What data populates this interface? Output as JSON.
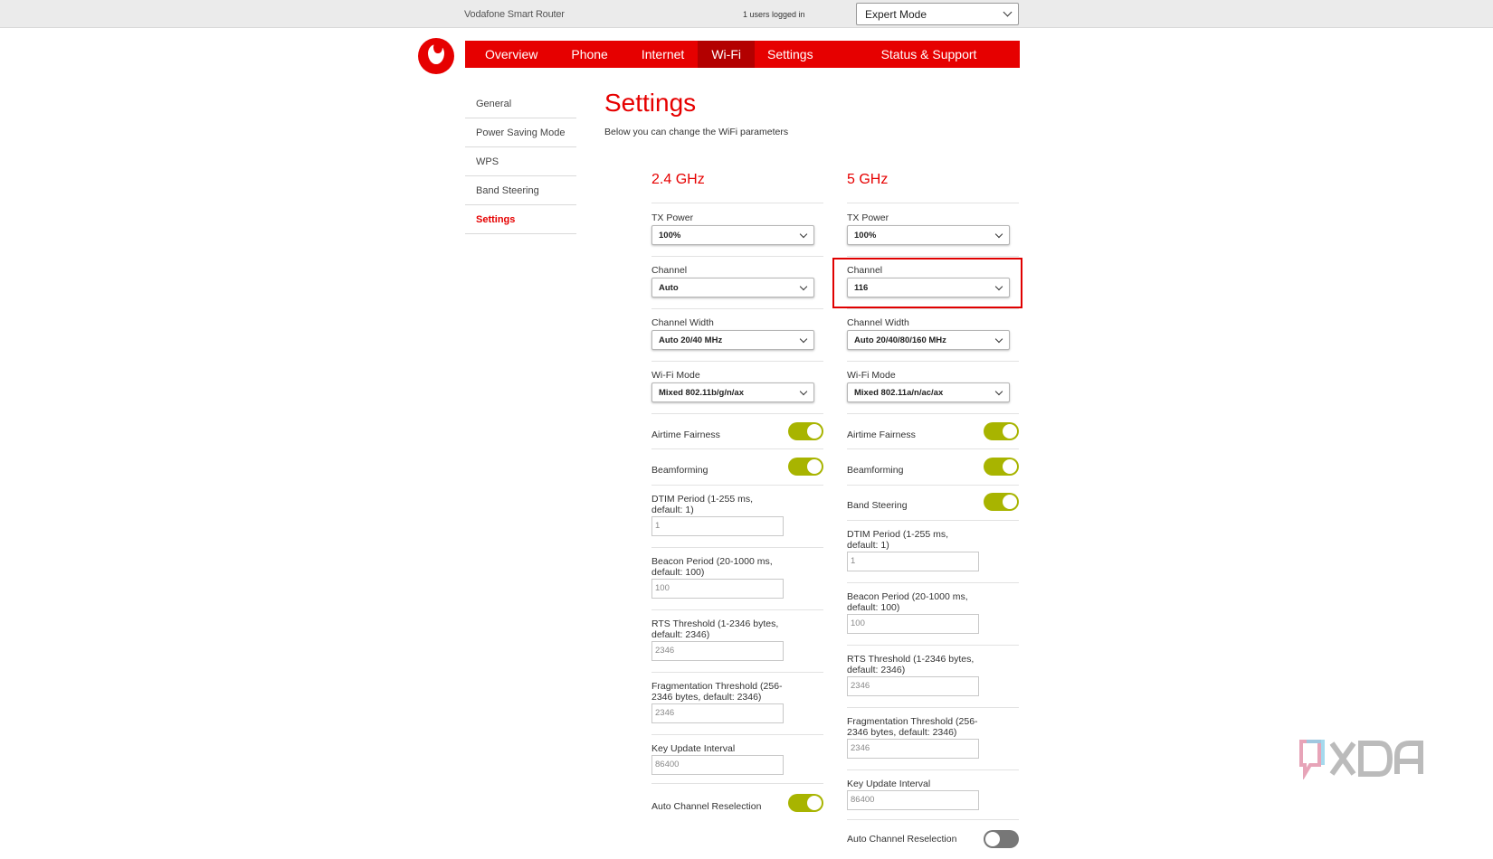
{
  "topbar": {
    "brand": "Vodafone Smart Router",
    "users": "1 users logged in",
    "mode": "Expert Mode"
  },
  "nav": [
    "Overview",
    "Phone",
    "Internet",
    "Wi-Fi",
    "Settings",
    "Status & Support"
  ],
  "sidebar": [
    "General",
    "Power Saving Mode",
    "WPS",
    "Band Steering",
    "Settings"
  ],
  "page": {
    "title": "Settings",
    "subtitle": "Below you can change the WiFi parameters"
  },
  "band24": {
    "title": "2.4 GHz",
    "tx_label": "TX Power",
    "tx_value": "100%",
    "channel_label": "Channel",
    "channel_value": "Auto",
    "width_label": "Channel Width",
    "width_value": "Auto 20/40 MHz",
    "mode_label": "Wi-Fi Mode",
    "mode_value": "Mixed 802.11b/g/n/ax",
    "airtime_label": "Airtime Fairness",
    "beam_label": "Beamforming",
    "dtim_label1": "DTIM Period (1-255 ms,",
    "dtim_label2": "default: 1)",
    "dtim_value": "1",
    "beacon_label1": "Beacon Period (20-1000 ms,",
    "beacon_label2": "default: 100)",
    "beacon_value": "100",
    "rts_label1": "RTS Threshold (1-2346 bytes,",
    "rts_label2": "default: 2346)",
    "rts_value": "2346",
    "frag_label1": "Fragmentation Threshold (256-",
    "frag_label2": "2346 bytes, default: 2346)",
    "frag_value": "2346",
    "key_label": "Key Update Interval",
    "key_value": "86400",
    "acr_label": "Auto Channel Reselection"
  },
  "band5": {
    "title": "5 GHz",
    "tx_label": "TX Power",
    "tx_value": "100%",
    "channel_label": "Channel",
    "channel_value": "116",
    "width_label": "Channel Width",
    "width_value": "Auto 20/40/80/160 MHz",
    "mode_label": "Wi-Fi Mode",
    "mode_value": "Mixed 802.11a/n/ac/ax",
    "airtime_label": "Airtime Fairness",
    "beam_label": "Beamforming",
    "steer_label": "Band Steering",
    "dtim_label1": "DTIM Period (1-255 ms,",
    "dtim_label2": "default: 1)",
    "dtim_value": "1",
    "beacon_label1": "Beacon Period (20-1000 ms,",
    "beacon_label2": "default: 100)",
    "beacon_value": "100",
    "rts_label1": "RTS Threshold (1-2346 bytes,",
    "rts_label2": "default: 2346)",
    "rts_value": "2346",
    "frag_label1": "Fragmentation Threshold (256-",
    "frag_label2": "2346 bytes, default: 2346)",
    "frag_value": "2346",
    "key_label": "Key Update Interval",
    "key_value": "86400",
    "acr_label": "Auto Channel Reselection"
  },
  "toggles": {
    "band24_airtime": true,
    "band24_beamforming": true,
    "band24_auto_channel": true,
    "band5_airtime": true,
    "band5_beamforming": true,
    "band5_band_steering": true,
    "band5_auto_channel": false
  },
  "colors": {
    "brand_red": "#e60000",
    "toggle_on": "#a8b400",
    "toggle_off": "#777777"
  },
  "icons": {
    "logo": "vodafone-logo-icon",
    "dropdown": "chevron-down-icon",
    "watermark": "xda-logo-icon"
  }
}
